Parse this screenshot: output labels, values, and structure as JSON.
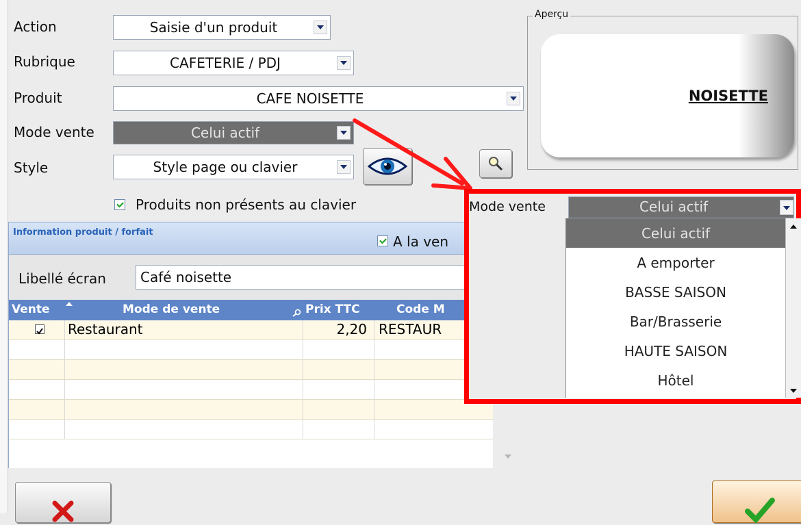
{
  "form": {
    "action_label": "Action",
    "action_value": "Saisie d'un produit",
    "rubrique_label": "Rubrique",
    "rubrique_value": "CAFETERIE / PDJ",
    "produit_label": "Produit",
    "produit_value": "CAFE NOISETTE",
    "mode_vente_label": "Mode vente",
    "mode_vente_value": "Celui actif",
    "style_label": "Style",
    "style_value": "Style page ou clavier",
    "non_presents_label": "Produits non présents au clavier"
  },
  "apercu": {
    "title": "Aperçu",
    "key_label": "NOISETTE"
  },
  "info": {
    "title": "Information produit / forfait",
    "a_la_vente_label": "A la ven",
    "libelle_label": "Libellé écran",
    "libelle_value": "Café noisette"
  },
  "grid": {
    "headers": [
      "Vente",
      "Mode de vente",
      "Prix TTC",
      "Code M"
    ],
    "rows": [
      {
        "checked": true,
        "mode": "Restaurant",
        "prix": "2,20",
        "code": "RESTAUR"
      }
    ]
  },
  "callout": {
    "mode_vente_label": "Mode vente",
    "mode_vente_value": "Celui actif",
    "options": [
      "Celui actif",
      "A emporter",
      "BASSE SAISON",
      "Bar/Brasserie",
      "HAUTE SAISON",
      "Hôtel"
    ],
    "selected_index": 0
  },
  "colors": {
    "callout_border": "#ff0000",
    "grid_header": "#5d85c8",
    "info_header": "#c4d7f0",
    "grid_row_bg": "#fdf9e6"
  },
  "icons": [
    "eye-icon",
    "magnifier-icon",
    "cancel-x-icon",
    "confirm-check-icon",
    "sort-up-icon",
    "chevron-down-icon",
    "red-arrow"
  ]
}
